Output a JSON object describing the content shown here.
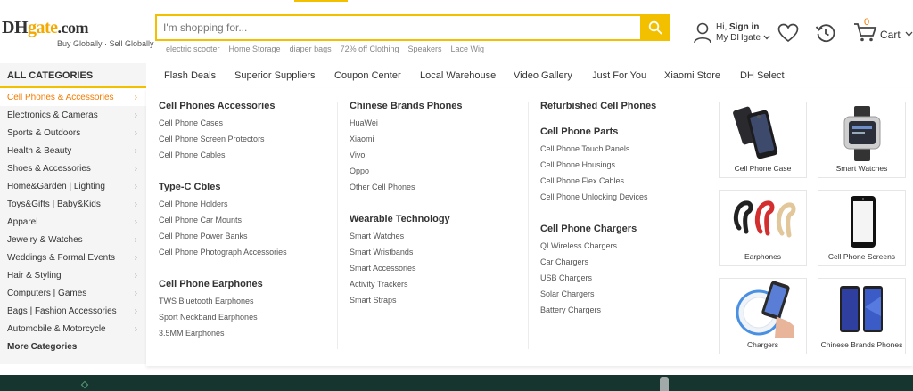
{
  "header": {
    "logo": {
      "dh": "DH",
      "gate": "gate",
      "com": ".com",
      "tagline": "Buy Globally · Sell Globally"
    },
    "search": {
      "placeholder": "I'm shopping for...",
      "value": ""
    },
    "hot_searches": [
      "electric scooter",
      "Home Storage",
      "diaper bags",
      "72% off Clothing",
      "Speakers",
      "Lace Wig"
    ],
    "account": {
      "greeting": "Hi,",
      "sign_in": "Sign in",
      "my_dhgate": "My DHgate"
    },
    "cart": {
      "count": "0",
      "label": "Cart"
    }
  },
  "nav": {
    "all_categories": "ALL CATEGORIES",
    "links": [
      "Flash Deals",
      "Superior Suppliers",
      "Coupon Center",
      "Local Warehouse",
      "Video Gallery",
      "Just For You",
      "Xiaomi Store",
      "DH Select"
    ]
  },
  "categories": [
    "Cell Phones & Accessories",
    "Electronics & Cameras",
    "Sports & Outdoors",
    "Health & Beauty",
    "Shoes & Accessories",
    "Home&Garden  |  Lighting",
    "Toys&Gifts  |  Baby&Kids",
    "Apparel",
    "Jewelry & Watches",
    "Weddings & Formal Events",
    "Hair & Styling",
    "Computers  |  Games",
    "Bags  |  Fashion Accessories",
    "Automobile & Motorcycle",
    "More Categories"
  ],
  "menu": {
    "col1": [
      {
        "title": "Cell Phones Accessories",
        "items": [
          "Cell Phone Cases",
          "Cell Phone Screen Protectors",
          "Cell Phone Cables"
        ]
      },
      {
        "title": "Type-C Cbles",
        "items": [
          "Cell Phone Holders",
          "Cell Phone Car Mounts",
          "Cell Phone Power Banks",
          "Cell Phone Photograph Accessories"
        ]
      },
      {
        "title": "Cell Phone Earphones",
        "items": [
          "TWS Bluetooth Earphones",
          "Sport Neckband Earphones",
          "3.5MM Earphones"
        ]
      }
    ],
    "col2": [
      {
        "title": "Chinese Brands Phones",
        "items": [
          "HuaWei",
          "Xiaomi",
          "Vivo",
          "Oppo",
          "Other Cell Phones"
        ]
      },
      {
        "title": "Wearable Technology",
        "items": [
          "Smart Watches",
          "Smart Wristbands",
          "Smart Accessories",
          "Activity Trackers",
          "Smart Straps"
        ]
      }
    ],
    "col3": [
      {
        "title": "Refurbished Cell Phones",
        "items": []
      },
      {
        "title": "Cell Phone Parts",
        "items": [
          "Cell Phone Touch Panels",
          "Cell Phone Housings",
          "Cell Phone Flex Cables",
          "Cell Phone Unlocking Devices"
        ]
      },
      {
        "title": "Cell Phone Chargers",
        "items": [
          "QI Wireless Chargers",
          "Car Chargers",
          "USB Chargers",
          "Solar Chargers",
          "Battery Chargers"
        ]
      }
    ],
    "tiles": [
      "Cell Phone Case",
      "Smart Watches",
      "Earphones",
      "Cell Phone Screens",
      "Chargers",
      "Chinese Brands Phones"
    ]
  },
  "colors": {
    "accent": "#f3c000",
    "active": "#f37b00",
    "footer": "#17352f"
  },
  "icons": [
    "search-icon",
    "user-icon",
    "chevron-down-icon",
    "heart-icon",
    "history-icon",
    "cart-icon",
    "chevron-right-icon"
  ]
}
